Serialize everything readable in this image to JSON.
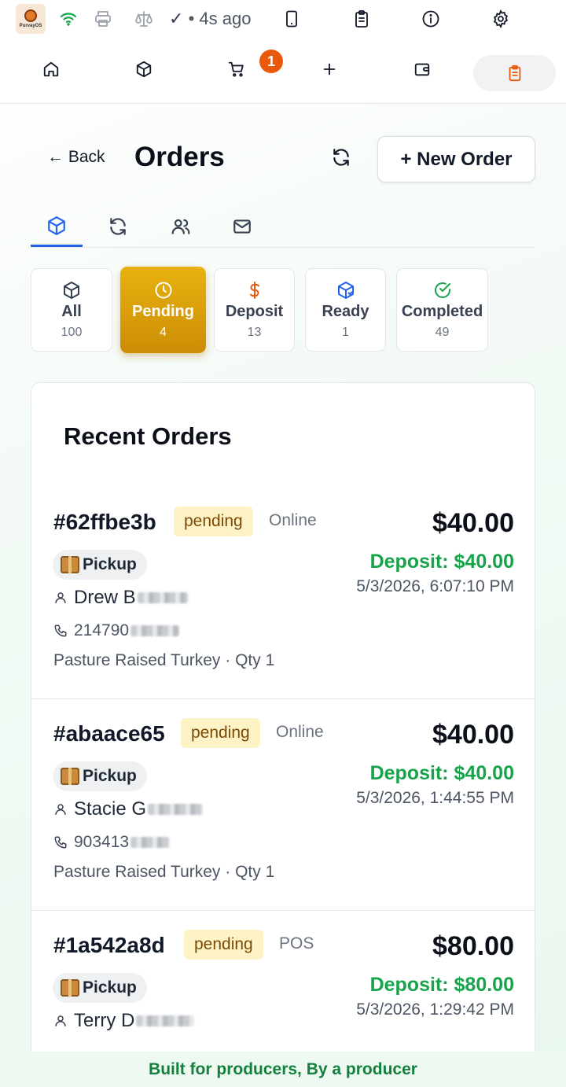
{
  "app": {
    "logo_text": "PurvayOS"
  },
  "status_bar": {
    "sync_check": "✓",
    "sync_text": "• 4s ago"
  },
  "nav": {
    "cart_badge": "1"
  },
  "header": {
    "back_label": "← Back",
    "title": "Orders",
    "new_order_label": "+ New Order"
  },
  "filters": [
    {
      "label": "All",
      "count": "100"
    },
    {
      "label": "Pending",
      "count": "4"
    },
    {
      "label": "Deposit",
      "count": "13"
    },
    {
      "label": "Ready",
      "count": "1"
    },
    {
      "label": "Completed",
      "count": "49"
    }
  ],
  "recent_orders": {
    "title": "Recent Orders",
    "orders": [
      {
        "id": "#62ffbe3b",
        "status": "pending",
        "channel": "Online",
        "fulfillment": "Pickup",
        "customer": "Drew B",
        "phone": "214790",
        "item": "Pasture Raised Turkey · Qty 1",
        "total": "$40.00",
        "deposit": "Deposit: $40.00",
        "date": "5/3/2026, 6:07:10 PM"
      },
      {
        "id": "#abaace65",
        "status": "pending",
        "channel": "Online",
        "fulfillment": "Pickup",
        "customer": "Stacie G",
        "phone": "903413",
        "item": "Pasture Raised Turkey · Qty 1",
        "total": "$40.00",
        "deposit": "Deposit: $40.00",
        "date": "5/3/2026, 1:44:55 PM"
      },
      {
        "id": "#1a542a8d",
        "status": "pending",
        "channel": "POS",
        "fulfillment": "Pickup",
        "customer": "Terry D",
        "phone": "",
        "item": "",
        "total": "$80.00",
        "deposit": "Deposit: $80.00",
        "date": "5/3/2026, 1:29:42 PM"
      }
    ]
  },
  "footer": {
    "tagline": "Built for producers, By a producer"
  },
  "colors": {
    "accent": "#2563eb",
    "pending_active": "#d99e0a",
    "deposit_green": "#16a34a",
    "badge_orange": "#ea580c"
  }
}
